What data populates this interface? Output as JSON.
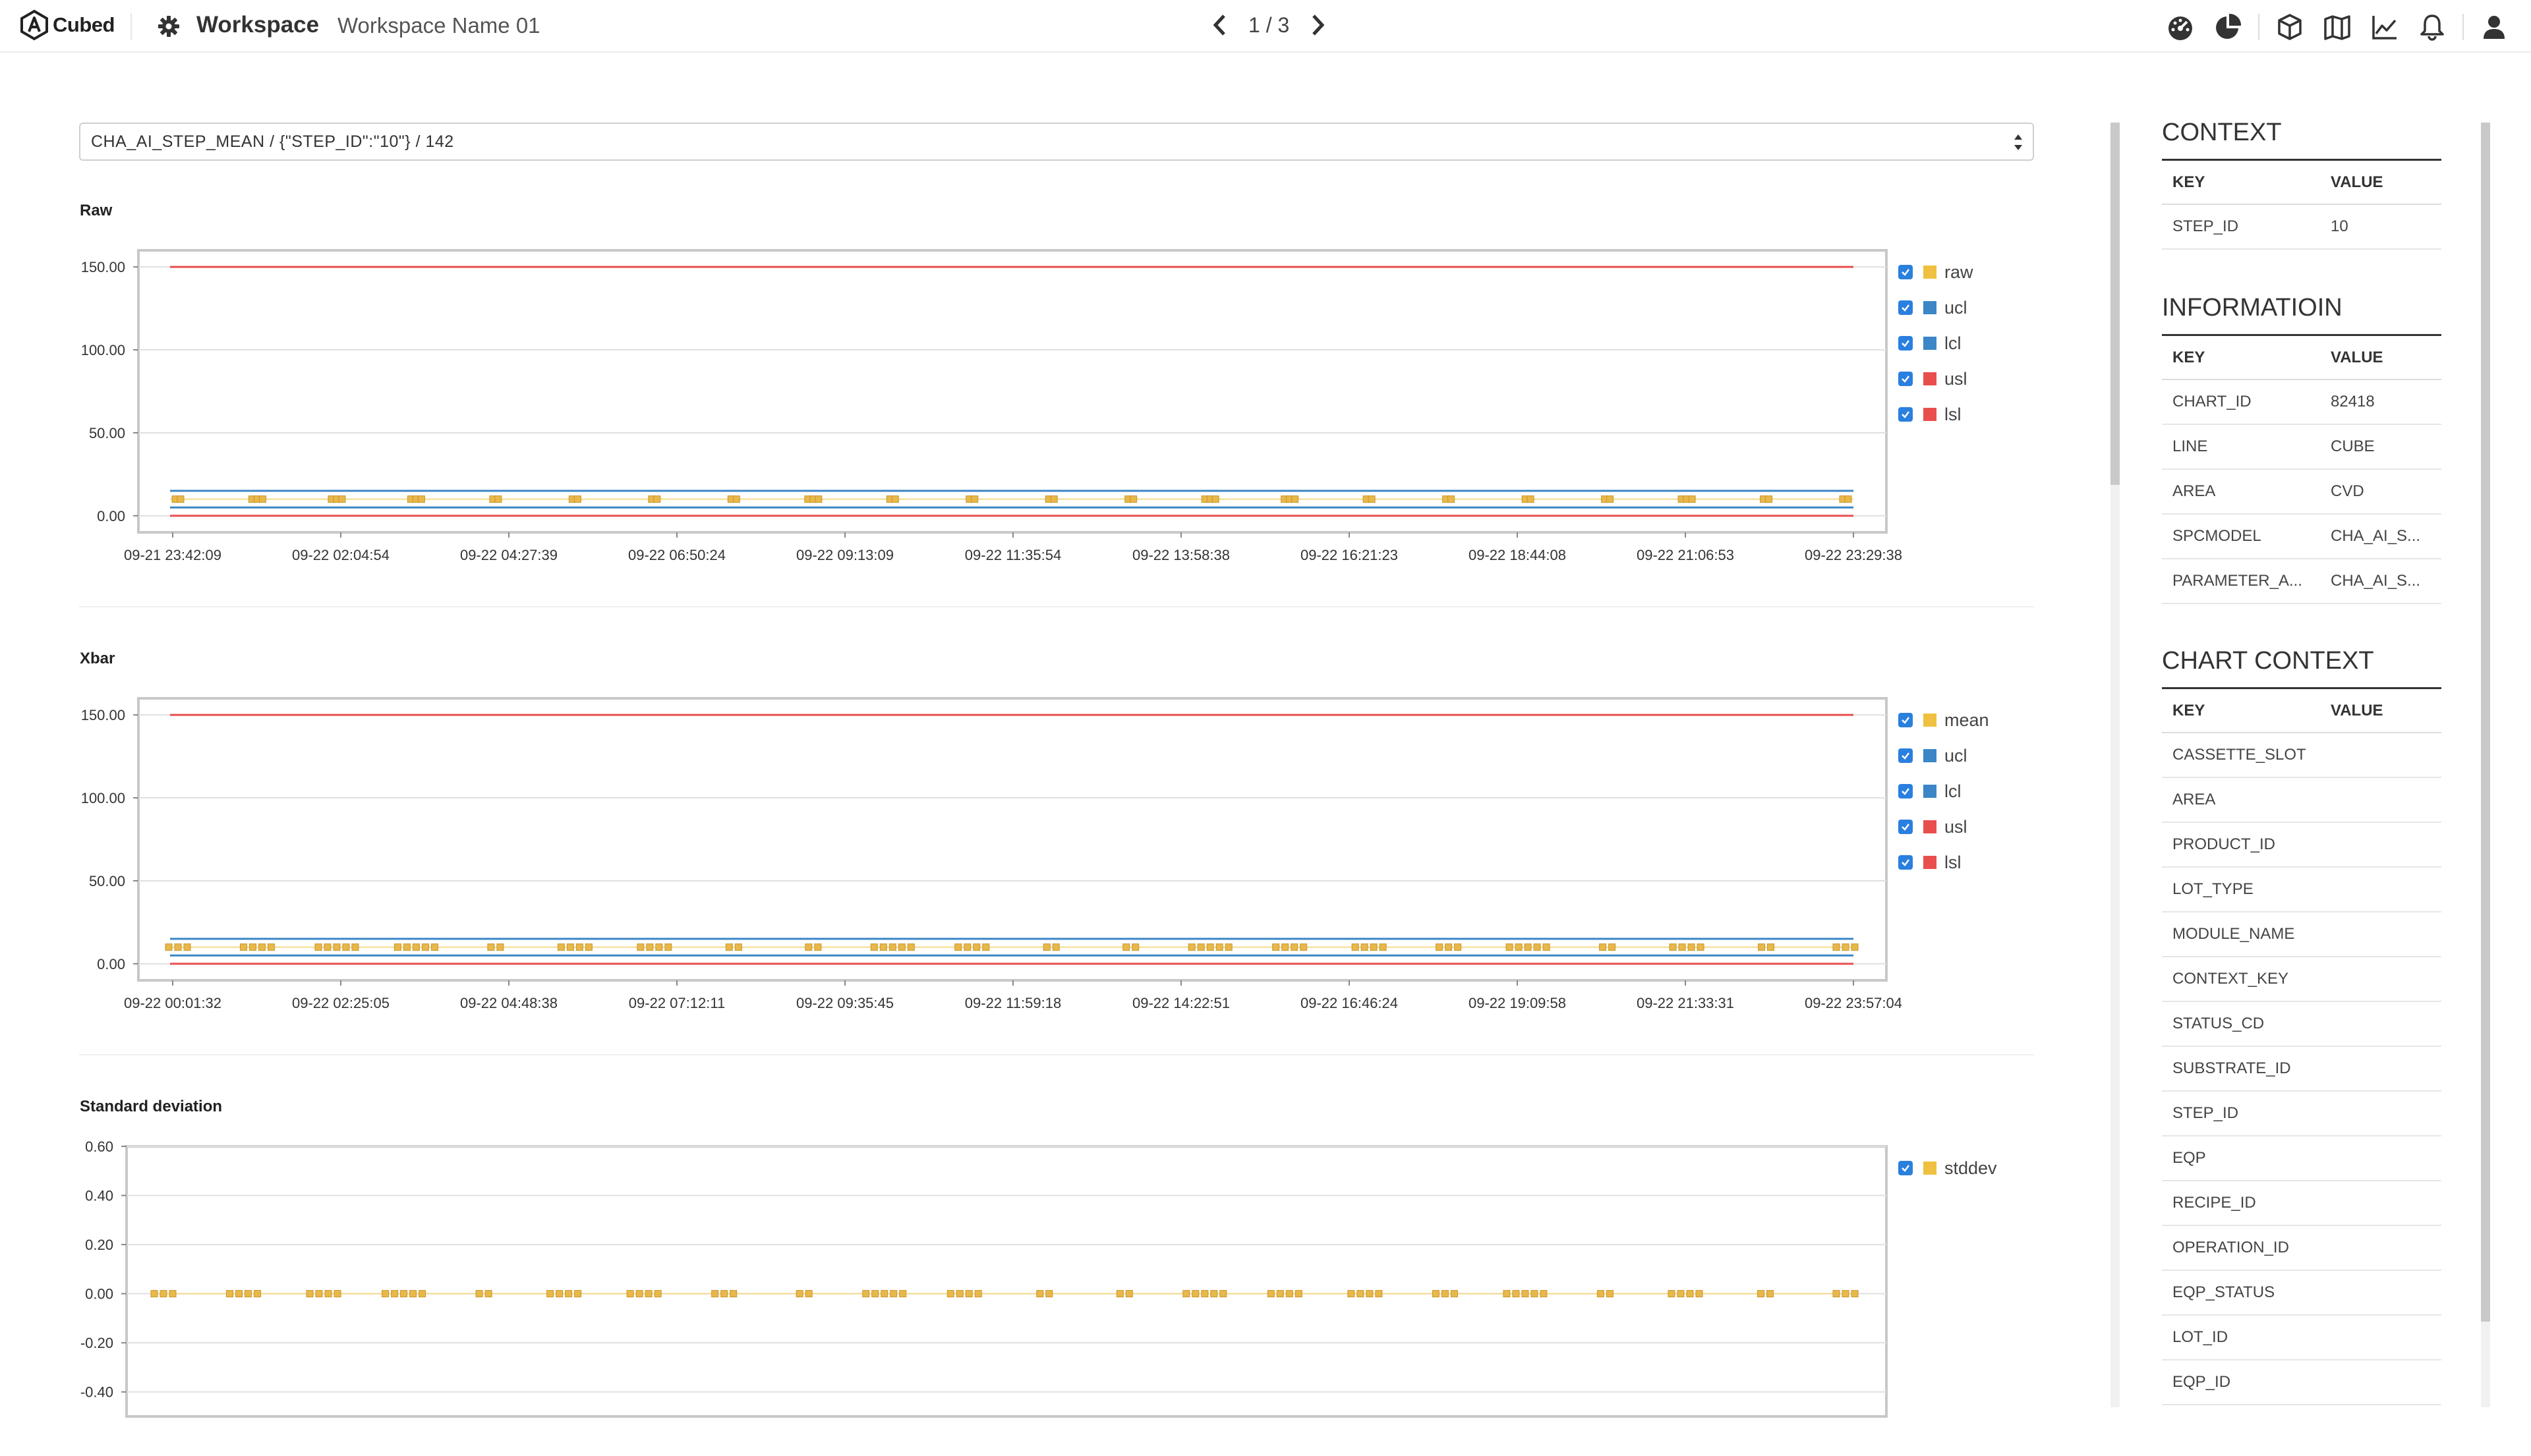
{
  "header": {
    "brand": "Cubed",
    "workspace_label": "Workspace",
    "workspace_name": "Workspace Name 01",
    "pager": "1 / 3"
  },
  "selector": {
    "value": "CHA_AI_STEP_MEAN / {\"STEP_ID\":\"10\"} / 142"
  },
  "colors": {
    "raw": "#f0c040",
    "ucl": "#3b86c6",
    "lcl": "#3b86c6",
    "usl": "#e94e4e",
    "lsl": "#e94e4e",
    "checkbox": "#2a7fdf"
  },
  "charts": [
    {
      "title": "Raw",
      "legend": [
        "raw",
        "ucl",
        "lcl",
        "usl",
        "lsl"
      ],
      "chart_data": {
        "type": "line",
        "title": "Raw",
        "yticks": [
          "150.00",
          "100.00",
          "50.00",
          "0.00"
        ],
        "ylim": [
          -10,
          160
        ],
        "xticks": [
          "09-21 23:42:09",
          "09-22 02:04:54",
          "09-22 04:27:39",
          "09-22 06:50:24",
          "09-22 09:13:09",
          "09-22 11:35:54",
          "09-22 13:58:38",
          "09-22 16:21:23",
          "09-22 18:44:08",
          "09-22 21:06:53",
          "09-22 23:29:38"
        ],
        "series": [
          {
            "name": "raw",
            "value": 10
          },
          {
            "name": "ucl",
            "value": 15
          },
          {
            "name": "lcl",
            "value": 5
          },
          {
            "name": "usl",
            "value": 150
          },
          {
            "name": "lsl",
            "value": 0
          }
        ],
        "clusters": [
          2,
          3,
          3,
          3,
          2,
          2,
          2,
          2,
          3,
          2,
          2,
          2,
          2,
          3,
          3,
          2,
          2,
          2,
          2,
          3,
          2,
          2
        ]
      }
    },
    {
      "title": "Xbar",
      "legend": [
        "mean",
        "ucl",
        "lcl",
        "usl",
        "lsl"
      ],
      "chart_data": {
        "type": "line",
        "title": "Xbar",
        "yticks": [
          "150.00",
          "100.00",
          "50.00",
          "0.00"
        ],
        "ylim": [
          -10,
          160
        ],
        "xticks": [
          "09-22 00:01:32",
          "09-22 02:25:05",
          "09-22 04:48:38",
          "09-22 07:12:11",
          "09-22 09:35:45",
          "09-22 11:59:18",
          "09-22 14:22:51",
          "09-22 16:46:24",
          "09-22 19:09:58",
          "09-22 21:33:31",
          "09-22 23:57:04"
        ],
        "series": [
          {
            "name": "mean",
            "value": 10
          },
          {
            "name": "ucl",
            "value": 15
          },
          {
            "name": "lcl",
            "value": 5
          },
          {
            "name": "usl",
            "value": 150
          },
          {
            "name": "lsl",
            "value": 0
          }
        ],
        "clusters": [
          3,
          4,
          5,
          5,
          2,
          4,
          4,
          2,
          2,
          5,
          4,
          2,
          2,
          5,
          4,
          4,
          3,
          5,
          2,
          4,
          2,
          3
        ]
      }
    },
    {
      "title": "Standard deviation",
      "legend": [
        "stddev"
      ],
      "chart_data": {
        "type": "line",
        "title": "Standard deviation",
        "yticks": [
          "0.60",
          "0.40",
          "0.20",
          "0.00",
          "-0.20",
          "-0.40"
        ],
        "ylim": [
          -0.5,
          0.6
        ],
        "xticks": [],
        "series": [
          {
            "name": "stddev",
            "value": 0
          }
        ],
        "clusters": [
          3,
          4,
          4,
          5,
          2,
          4,
          4,
          3,
          2,
          5,
          4,
          2,
          2,
          5,
          4,
          4,
          3,
          5,
          2,
          4,
          2,
          3
        ]
      }
    }
  ],
  "panel": {
    "context": {
      "title": "CONTEXT",
      "key_header": "KEY",
      "value_header": "VALUE",
      "rows": [
        {
          "k": "STEP_ID",
          "v": "10"
        }
      ]
    },
    "information": {
      "title": "INFORMATIOIN",
      "key_header": "KEY",
      "value_header": "VALUE",
      "rows": [
        {
          "k": "CHART_ID",
          "v": "82418"
        },
        {
          "k": "LINE",
          "v": "CUBE"
        },
        {
          "k": "AREA",
          "v": "CVD"
        },
        {
          "k": "SPCMODEL",
          "v": "CHA_AI_S..."
        },
        {
          "k": "PARAMETER_A...",
          "v": "CHA_AI_S..."
        }
      ]
    },
    "chart_context": {
      "title": "CHART CONTEXT",
      "key_header": "KEY",
      "value_header": "VALUE",
      "rows": [
        {
          "k": "CASSETTE_SLOT",
          "v": ""
        },
        {
          "k": "AREA",
          "v": ""
        },
        {
          "k": "PRODUCT_ID",
          "v": ""
        },
        {
          "k": "LOT_TYPE",
          "v": ""
        },
        {
          "k": "MODULE_NAME",
          "v": ""
        },
        {
          "k": "CONTEXT_KEY",
          "v": ""
        },
        {
          "k": "STATUS_CD",
          "v": ""
        },
        {
          "k": "SUBSTRATE_ID",
          "v": ""
        },
        {
          "k": "STEP_ID",
          "v": ""
        },
        {
          "k": "EQP",
          "v": ""
        },
        {
          "k": "RECIPE_ID",
          "v": ""
        },
        {
          "k": "OPERATION_ID",
          "v": ""
        },
        {
          "k": "EQP_STATUS",
          "v": ""
        },
        {
          "k": "LOT_ID",
          "v": ""
        },
        {
          "k": "EQP_ID",
          "v": ""
        }
      ]
    }
  }
}
